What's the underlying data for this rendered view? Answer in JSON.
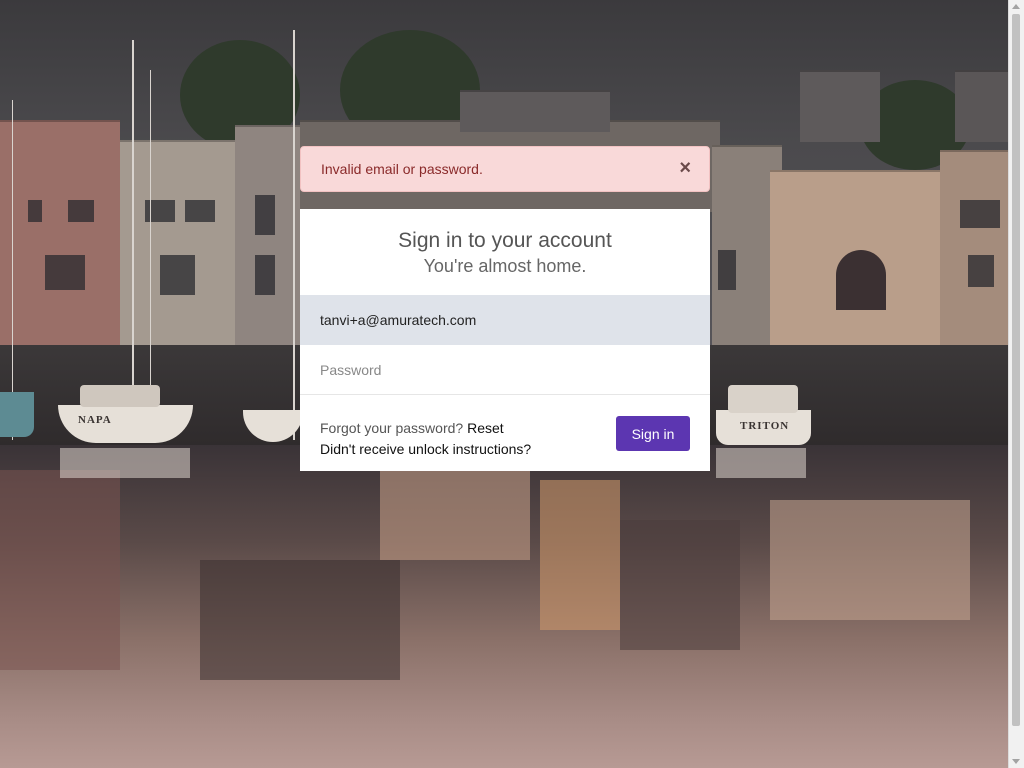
{
  "alert": {
    "message": "Invalid email or password.",
    "close_icon": "close-icon",
    "close_glyph": "×",
    "background_color": "#f9d9d9",
    "text_color": "#8a2a2a"
  },
  "login": {
    "title": "Sign in to your account",
    "subtitle": "You're almost home.",
    "email": {
      "value": "tanvi+a@amuratech.com"
    },
    "password": {
      "placeholder": "Password"
    },
    "forgot_text": "Forgot your password?",
    "reset_label": "Reset",
    "unlock_label": "Didn't receive unlock instructions?",
    "signin_label": "Sign in",
    "accent_color": "#5c36b1"
  },
  "background": {
    "boat_names": [
      "NAPA",
      "TRITON"
    ]
  }
}
